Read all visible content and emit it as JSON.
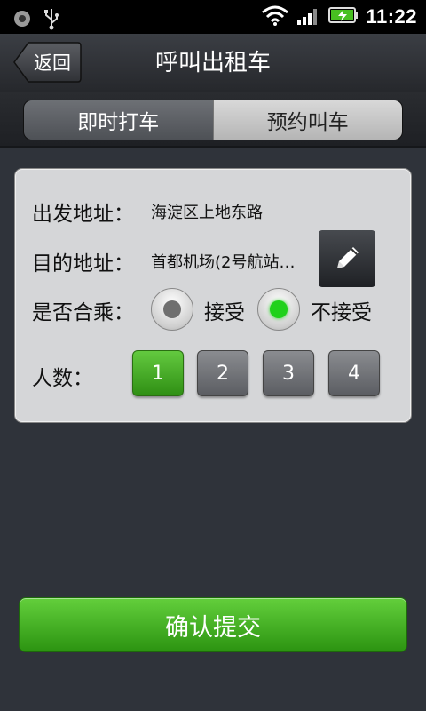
{
  "status_bar": {
    "time": "11:22",
    "icons": [
      "notification-icon",
      "usb-icon",
      "wifi-icon",
      "signal-icon",
      "battery-charging-icon"
    ],
    "battery_color": "#48c021"
  },
  "header": {
    "back_label": "返回",
    "title": "呼叫出租车"
  },
  "tabs": [
    {
      "label": "即时打车",
      "active": true
    },
    {
      "label": "预约叫车",
      "active": false
    }
  ],
  "form": {
    "origin_label": "出发地址：",
    "origin_value": "海淀区上地东路",
    "destination_label": "目的地址：",
    "destination_value": "首都机场(2号航站…",
    "edit_icon": "pencil-icon",
    "carpool_label": "是否合乘：",
    "carpool_options": [
      {
        "label": "接受",
        "selected": false
      },
      {
        "label": "不接受",
        "selected": true
      }
    ],
    "passengers_label": "人数：",
    "passenger_options": [
      "1",
      "2",
      "3",
      "4"
    ],
    "passenger_selected": "1"
  },
  "submit_label": "确认提交",
  "colors": {
    "accent_green": "#3aa31a",
    "background": "#2f333a"
  }
}
